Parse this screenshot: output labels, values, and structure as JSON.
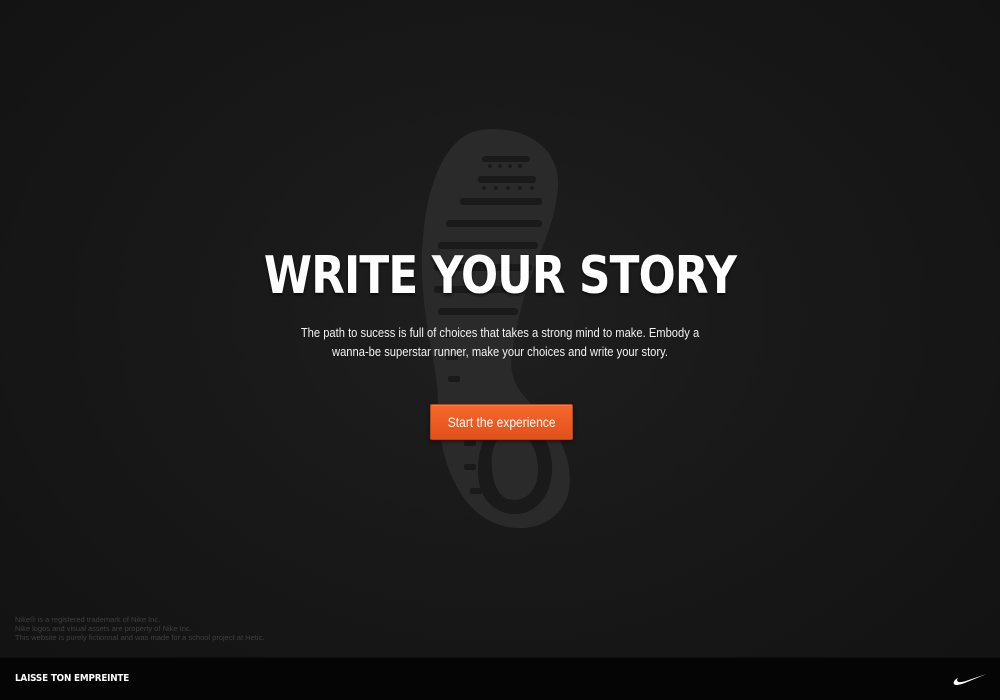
{
  "hero": {
    "headline": "WRITE YOUR STORY",
    "intro_line1": "The path to sucess is full of choices that takes a strong mind to make. Embody a",
    "intro_line2": "wanna-be superstar runner, make your choices and write your story.",
    "cta_label": "Start the experience"
  },
  "legal": {
    "line1": "Nike® is a registered trademark of Nike Inc.",
    "line2": "Nike logos and visual assets are property of Nike Inc.",
    "line3": "This website is purely fictionnal and was made for a school project at Hetic."
  },
  "footer": {
    "brand_label": "LAISSE TON EMPREINTE"
  },
  "icons": {
    "footprint": "footprint-icon",
    "logo": "nike-swoosh-icon"
  },
  "colors": {
    "background": "#151515",
    "accent": "#ee5a22",
    "footer_bar": "#050505"
  }
}
